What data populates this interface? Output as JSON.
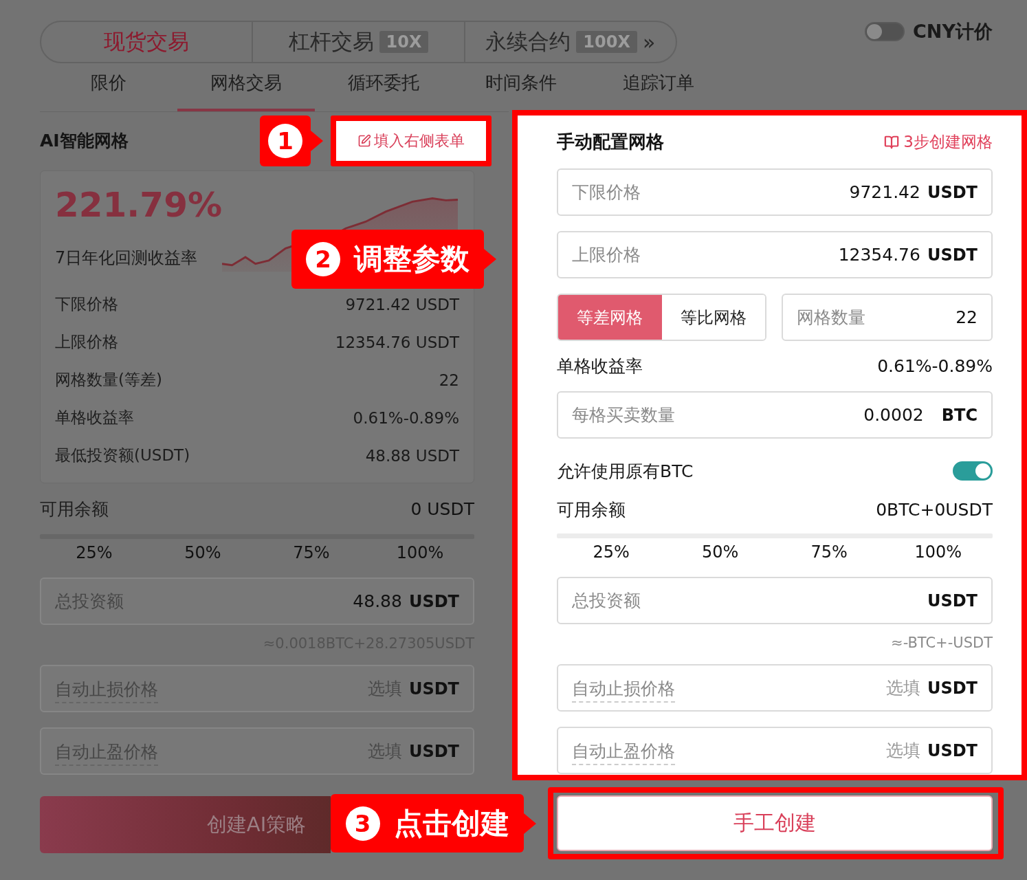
{
  "market_tabs": [
    {
      "label": "现货交易",
      "selected": true
    },
    {
      "label": "杠杆交易",
      "badge": "10X",
      "selected": false
    },
    {
      "label": "永续合约",
      "badge": "100X",
      "more": "»",
      "selected": false
    }
  ],
  "price_toggle": {
    "label": "CNY计价",
    "on": false
  },
  "order_tabs": [
    {
      "label": "限价",
      "selected": false
    },
    {
      "label": "网格交易",
      "selected": true
    },
    {
      "label": "循环委托",
      "selected": false
    },
    {
      "label": "时间条件",
      "selected": false
    },
    {
      "label": "追踪订单",
      "selected": false
    }
  ],
  "ai_grid": {
    "title": "AI智能网格",
    "fill_button": "填入右侧表单",
    "return_rate": "221.79%",
    "return_label": "7日年化回测收益率",
    "stats": [
      {
        "label": "下限价格",
        "value": "9721.42 USDT"
      },
      {
        "label": "上限价格",
        "value": "12354.76 USDT"
      },
      {
        "label": "网格数量(等差)",
        "value": "22"
      },
      {
        "label": "单格收益率",
        "value": "0.61%-0.89%"
      },
      {
        "label": "最低投资额(USDT)",
        "value": "48.88 USDT"
      }
    ],
    "balance": {
      "label": "可用余额",
      "value": "0 USDT"
    },
    "percent_options": [
      "25%",
      "50%",
      "75%",
      "100%"
    ],
    "percent_slider": {
      "level": 0
    },
    "amount_field": {
      "label": "总投资额",
      "value": "48.88",
      "unit": "USDT"
    },
    "note": "≈0.0018BTC+28.27305USDT",
    "optional_fields": [
      {
        "label": "自动止损价格",
        "placeholder": "选填",
        "unit": "USDT"
      },
      {
        "label": "自动止盈价格",
        "placeholder": "选填",
        "unit": "USDT"
      }
    ],
    "create_button": "创建AI策略"
  },
  "manual_grid": {
    "title": "手动配置网格",
    "guide_link": "3步创建网格",
    "price_fields": [
      {
        "label": "下限价格",
        "value": "9721.42",
        "unit": "USDT"
      },
      {
        "label": "上限价格",
        "value": "12354.76",
        "unit": "USDT"
      }
    ],
    "grid_types": [
      {
        "label": "等差网格",
        "selected": true
      },
      {
        "label": "等比网格",
        "selected": false
      }
    ],
    "grid_count": {
      "label": "网格数量",
      "value": "22"
    },
    "profit_rate": {
      "label": "单格收益率",
      "value": "0.61%-0.89%"
    },
    "qty_field": {
      "label": "每格买卖数量",
      "value": "0.0002",
      "unit": "BTC"
    },
    "use_btc": {
      "label": "允许使用原有BTC",
      "on": true
    },
    "balance": {
      "label": "可用余额",
      "value": "0BTC+0USDT"
    },
    "percent_options": [
      "25%",
      "50%",
      "75%",
      "100%"
    ],
    "percent_slider": {
      "level": 0
    },
    "amount_field": {
      "label": "总投资额",
      "unit": "USDT"
    },
    "note": "≈-BTC+-USDT",
    "optional_fields": [
      {
        "label": "自动止损价格",
        "placeholder": "选填",
        "unit": "USDT"
      },
      {
        "label": "自动止盈价格",
        "placeholder": "选填",
        "unit": "USDT"
      }
    ],
    "create_button": "手工创建"
  },
  "callouts": [
    {
      "number": "1"
    },
    {
      "number": "2",
      "text": "调整参数"
    },
    {
      "number": "3",
      "text": "点击创建"
    }
  ]
}
